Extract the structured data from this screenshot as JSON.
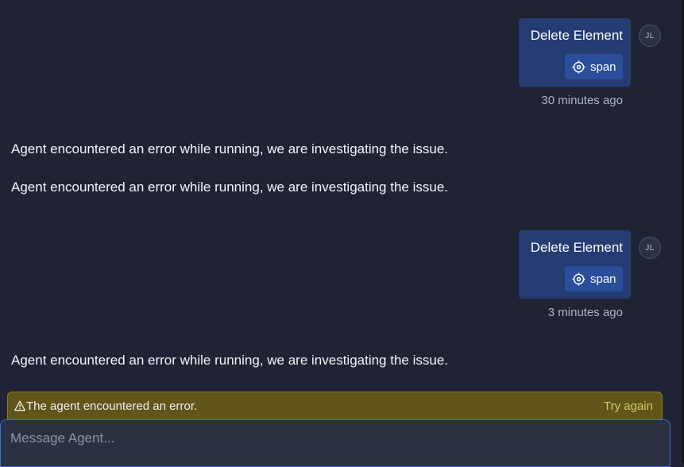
{
  "messages": [
    {
      "role": "user",
      "title": "Delete Element",
      "chip_label": "span",
      "avatar": "JL",
      "time": "30 minutes ago"
    },
    {
      "role": "agent",
      "text": "Agent encountered an error while running, we are investigating the issue."
    },
    {
      "role": "agent",
      "text": "Agent encountered an error while running, we are investigating the issue."
    },
    {
      "role": "user",
      "title": "Delete Element",
      "chip_label": "span",
      "avatar": "JL",
      "time": "3 minutes ago"
    },
    {
      "role": "agent",
      "text": "Agent encountered an error while running, we are investigating the issue."
    }
  ],
  "error_banner": {
    "icon": "warning-triangle-icon",
    "text": "The agent encountered an error.",
    "action": "Try again"
  },
  "composer": {
    "placeholder": "Message Agent..."
  },
  "icons": {
    "chip": "target-crosshair-icon"
  },
  "colors": {
    "background": "#1f2333",
    "user_bubble": "#253c73",
    "chip": "#2a4e9a",
    "error_banner": "#625519",
    "try_again": "#d6c46a",
    "composer_border": "#3b6fd6"
  }
}
